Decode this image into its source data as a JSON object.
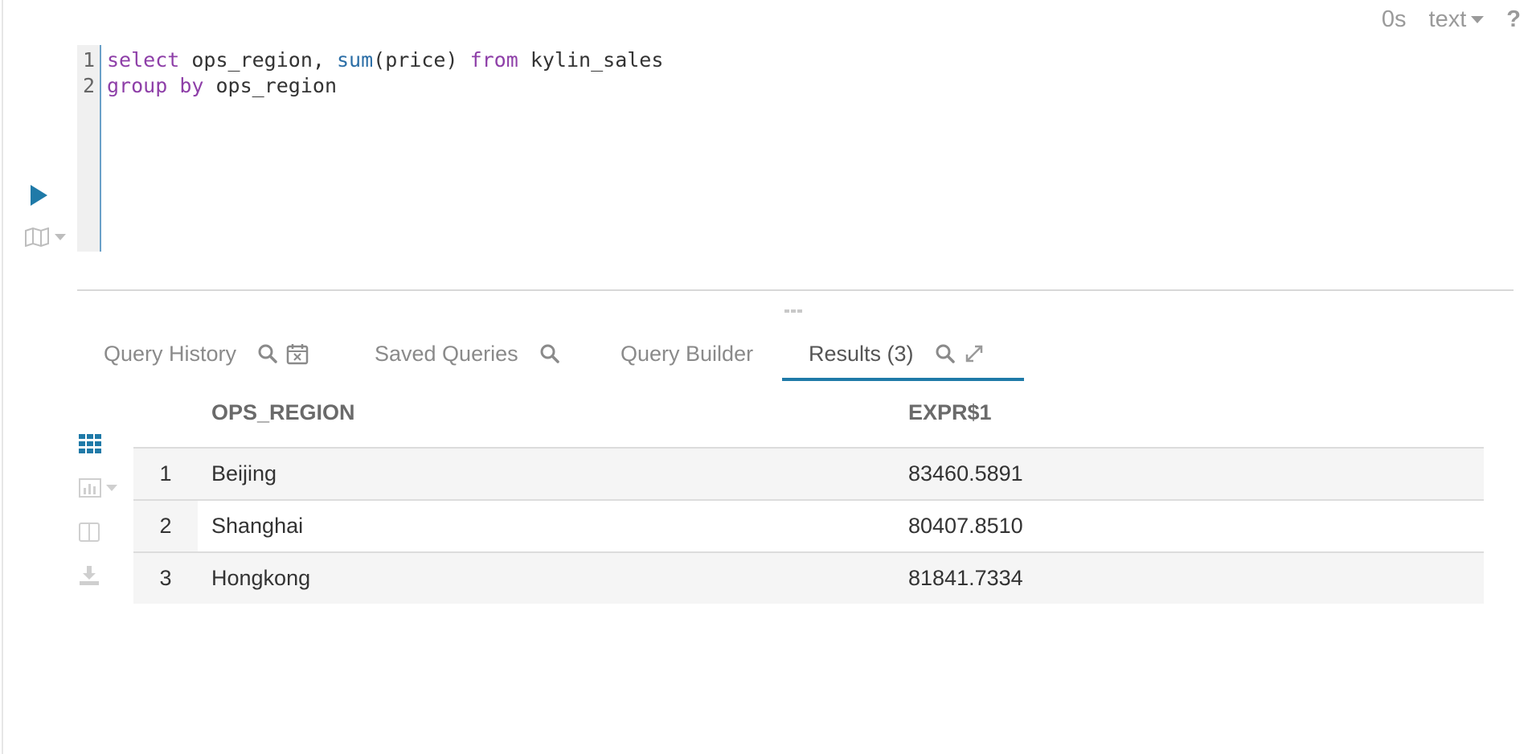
{
  "toolbar": {
    "elapsed": "0s",
    "format_label": "text",
    "help_label": "?"
  },
  "editor": {
    "line_numbers": [
      "1",
      "2"
    ],
    "line1": {
      "kw_select": "select",
      "t1": " ops_region, ",
      "fn_sum": "sum",
      "t2": "(price) ",
      "kw_from": "from",
      "t3": " kylin_sales"
    },
    "line2": {
      "kw_group": "group",
      "sp": " ",
      "kw_by": "by",
      "t1": " ops_region"
    }
  },
  "tabs": [
    {
      "label": "Query History"
    },
    {
      "label": "Saved Queries"
    },
    {
      "label": "Query Builder"
    },
    {
      "label": "Results (3)"
    }
  ],
  "results": {
    "columns": [
      "OPS_REGION",
      "EXPR$1"
    ],
    "rows": [
      {
        "num": "1",
        "ops_region": "Beijing",
        "expr": "83460.5891"
      },
      {
        "num": "2",
        "ops_region": "Shanghai",
        "expr": "80407.8510"
      },
      {
        "num": "3",
        "ops_region": "Hongkong",
        "expr": "81841.7334"
      }
    ]
  },
  "colors": {
    "accent": "#1f7aa8",
    "keyword": "#8e3fa8",
    "function": "#2b6ea6"
  },
  "icons": [
    "play-icon",
    "map-icon",
    "search-icon",
    "calendar-remove-icon",
    "expand-icon",
    "grid-icon",
    "bar-chart-icon",
    "columns-icon",
    "download-icon"
  ]
}
